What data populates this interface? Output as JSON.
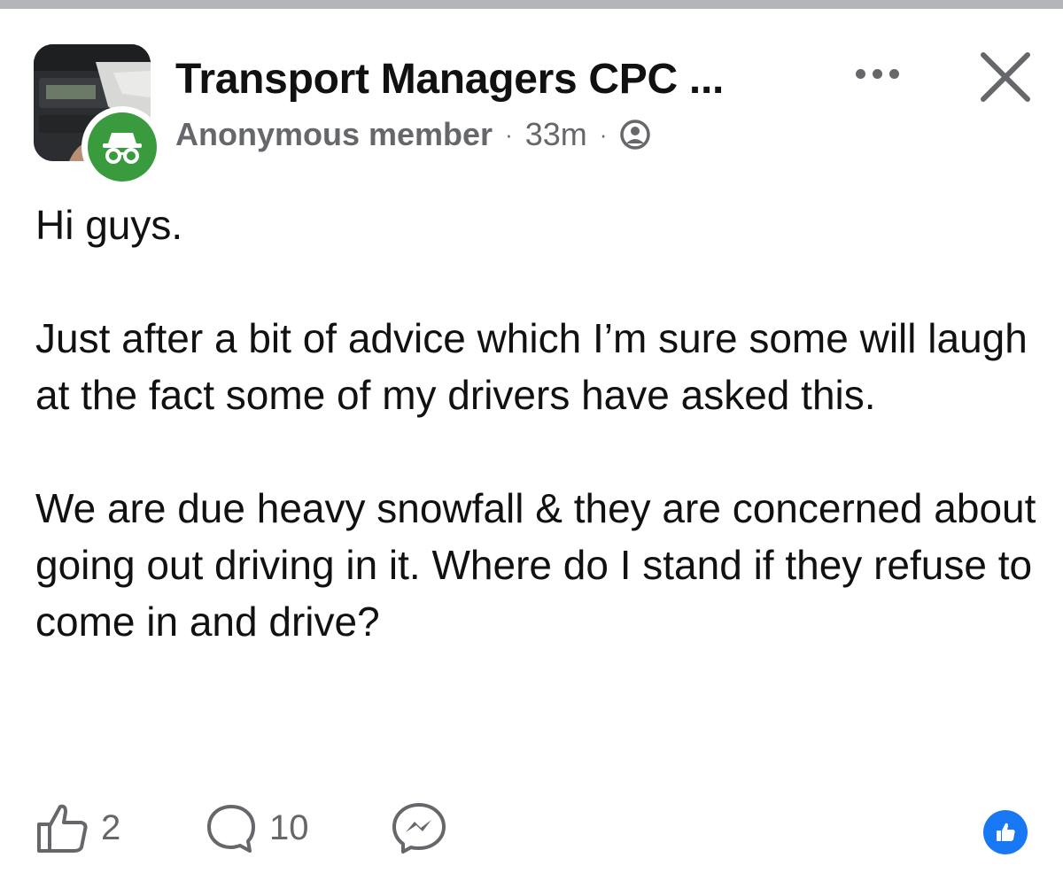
{
  "post": {
    "group_name": "Transport Managers CPC ...",
    "author": "Anonymous member",
    "separator": "·",
    "time": "33m",
    "body": [
      "Hi guys.",
      "Just after a bit of advice which I’m sure some will laugh at the fact some of my drivers have asked this.",
      "We are due heavy snowfall & they are concerned about going out driving in it. Where do I stand if they refuse to come in and drive?"
    ],
    "reactions": {
      "like_count": "2",
      "comment_count": "10"
    }
  },
  "icons": {
    "more": "more-horizontal-icon",
    "close": "close-icon",
    "privacy": "members-only-icon",
    "anonymous_badge": "anonymous-incognito-icon",
    "like": "thumbs-up-outline-icon",
    "comment": "comment-bubble-icon",
    "share": "messenger-icon",
    "reaction_badge": "like-reaction-icon"
  },
  "colors": {
    "text_primary": "#111111",
    "text_secondary": "#65676b",
    "anonymous_green": "#3a9a3e",
    "facebook_blue": "#1877f2",
    "divider": "#b3b5b8"
  }
}
